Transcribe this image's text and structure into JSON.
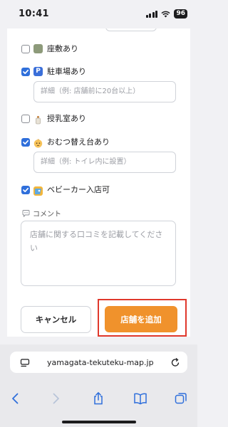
{
  "status_bar": {
    "time": "10:41",
    "battery": "96"
  },
  "options": [
    {
      "label": "座敷あり",
      "checked": false,
      "icon": "tatami-icon"
    },
    {
      "label": "駐車場あり",
      "checked": true,
      "icon": "parking-icon",
      "detail_placeholder": "詳細（例: 店舗前に20台以上）"
    },
    {
      "label": "授乳室あり",
      "checked": false,
      "icon": "baby-bottle-icon"
    },
    {
      "label": "おむつ替え台あり",
      "checked": true,
      "icon": "baby-face-icon",
      "detail_placeholder": "詳細（例: トイレ内に設置）"
    },
    {
      "label": "ベビーカー入店可",
      "checked": true,
      "icon": "stroller-icon"
    }
  ],
  "comment": {
    "label": "コメント",
    "placeholder": "店舗に関する口コミを記載してください"
  },
  "buttons": {
    "cancel": "キャンセル",
    "add": "店舗を追加"
  },
  "browser": {
    "url": "yamagata-tekuteku-map.jp"
  },
  "colors": {
    "accent_orange": "#f0922c",
    "checkbox_blue": "#2f6fdb",
    "highlight_red": "#e0382c"
  }
}
